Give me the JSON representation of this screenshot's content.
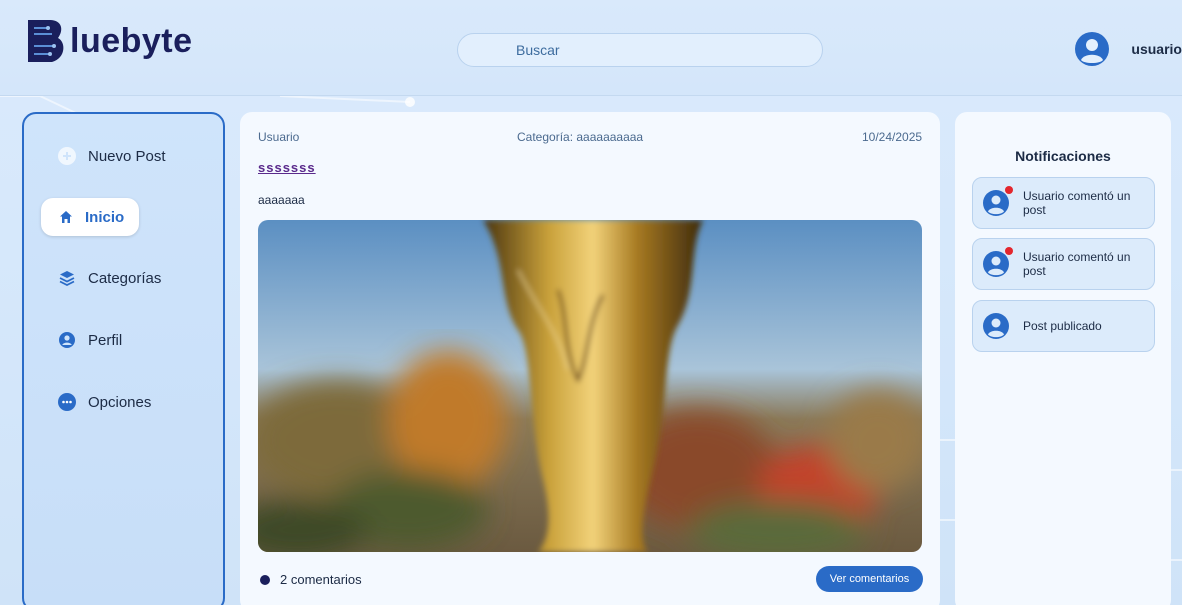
{
  "header": {
    "logo_text": "luebyte",
    "logo_mark": "B",
    "search_placeholder": "Buscar",
    "user_name": "usuario"
  },
  "sidebar": {
    "items": [
      {
        "label": "Nuevo Post",
        "icon": "plus-icon"
      },
      {
        "label": "Inicio",
        "icon": "home-icon",
        "active": true
      },
      {
        "label": "Categorías",
        "icon": "layers-icon"
      },
      {
        "label": "Perfil",
        "icon": "user-circle-icon"
      },
      {
        "label": "Opciones",
        "icon": "more-icon"
      }
    ]
  },
  "post": {
    "author": "Usuario",
    "category": "Categoría: aaaaaaaaaa",
    "date": "10/24/2025",
    "title": "sssssss",
    "body": "aaaaaaa",
    "comments_count": "2 comentarios",
    "see_comments_label": "Ver comentarios"
  },
  "notifications": {
    "title": "Notificaciones",
    "items": [
      {
        "text": "Usuario comentó un post",
        "unread": true
      },
      {
        "text": "Usuario comentó un post",
        "unread": true
      },
      {
        "text": "Post publicado",
        "unread": false
      }
    ]
  },
  "colors": {
    "accent": "#2a6bc7",
    "brand_dark": "#1a1f5c",
    "unread_badge": "#e3262d",
    "title_link": "#5a2a8c"
  }
}
